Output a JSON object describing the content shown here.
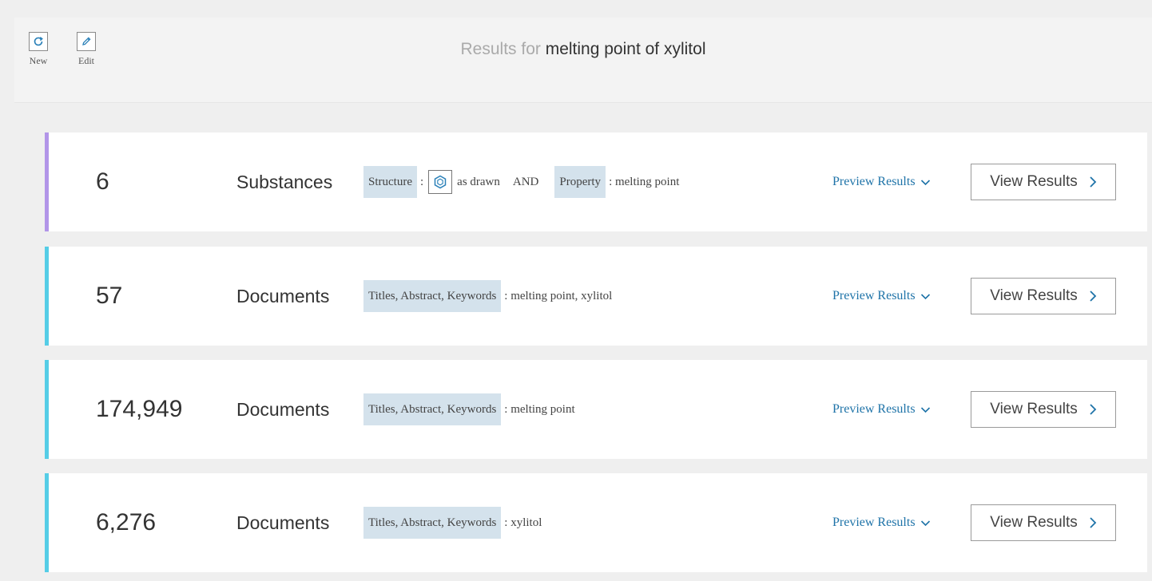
{
  "toolbar": {
    "new_label": "New",
    "edit_label": "Edit"
  },
  "header": {
    "prefix": "Results for",
    "query": "melting point of xylitol"
  },
  "colors": {
    "accent_purple": "#b295e8",
    "accent_cyan": "#55cde6",
    "link_blue": "#1e73a8",
    "chip_bg": "#d4e2ec"
  },
  "rows": [
    {
      "count": "6",
      "type": "Substances",
      "structure_chip": "Structure",
      "structure_colon": ":",
      "structure_icon": "structure-hexagon-icon",
      "structure_text": "as drawn",
      "and": "AND",
      "property_chip": "Property",
      "property_text": ": melting point",
      "preview": "Preview Results",
      "view": "View Results"
    },
    {
      "count": "57",
      "type": "Documents",
      "chip": "Titles, Abstract, Keywords",
      "text": ": melting point, xylitol",
      "preview": "Preview Results",
      "view": "View Results"
    },
    {
      "count": "174,949",
      "type": "Documents",
      "chip": "Titles, Abstract, Keywords",
      "text": ": melting point",
      "preview": "Preview Results",
      "view": "View Results"
    },
    {
      "count": "6,276",
      "type": "Documents",
      "chip": "Titles, Abstract, Keywords",
      "text": ": xylitol",
      "preview": "Preview Results",
      "view": "View Results"
    }
  ]
}
